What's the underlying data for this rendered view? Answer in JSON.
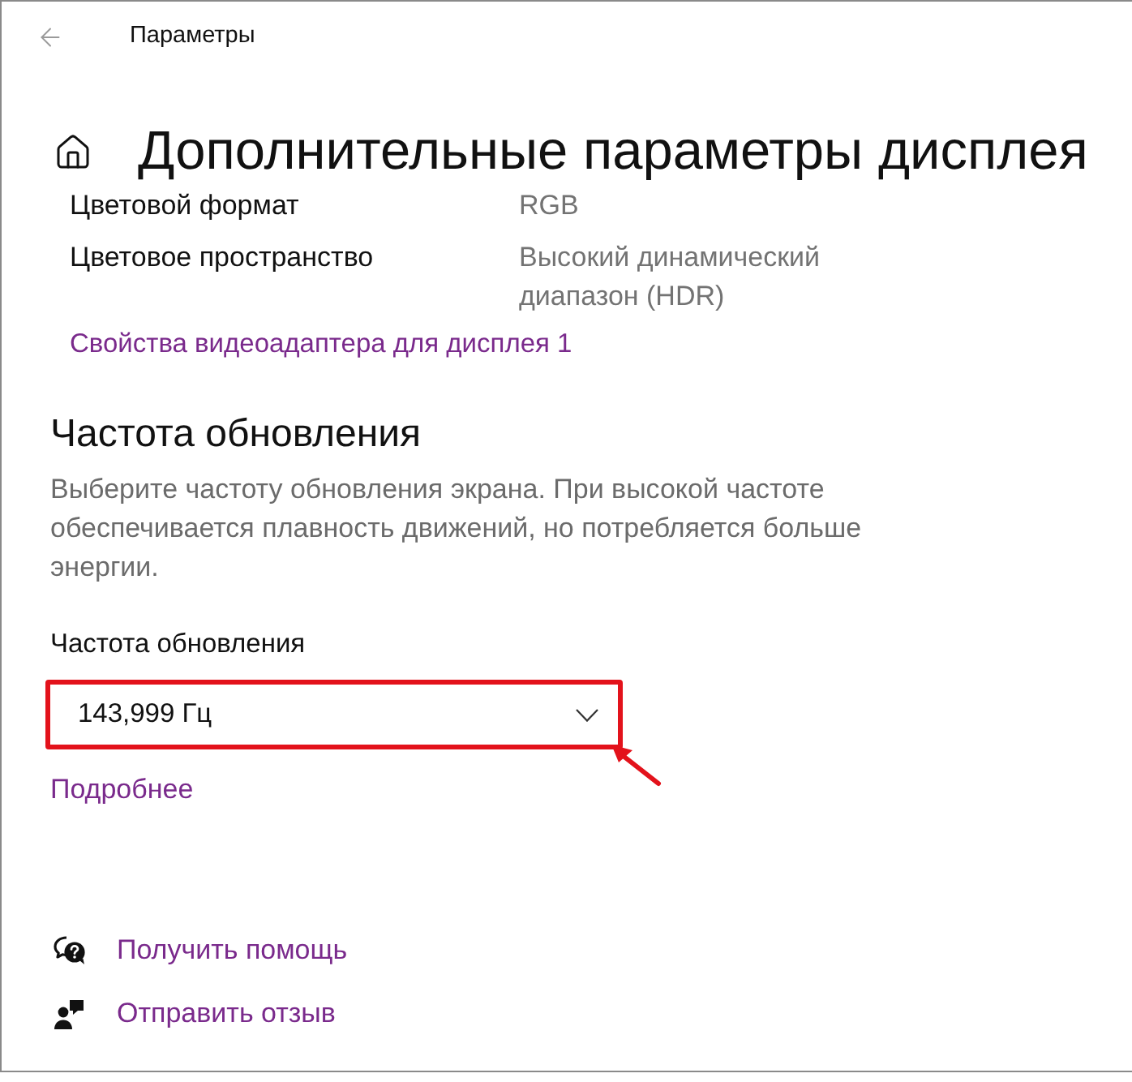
{
  "window": {
    "title": "Параметры"
  },
  "page": {
    "title": "Дополнительные параметры дисплея"
  },
  "info_rows": [
    {
      "label": "Цветовой формат",
      "value": "RGB"
    },
    {
      "label": "Цветовое пространство",
      "value": "Высокий динамический диапазон (HDR)"
    }
  ],
  "adapter_link": "Свойства видеоадаптера для дисплея 1",
  "refresh_section": {
    "heading": "Частота обновления",
    "description": "Выберите частоту обновления экрана. При высокой частоте обеспечивается плавность движений, но потребляется больше энергии.",
    "field_label": "Частота обновления",
    "dropdown": {
      "value": "143,999 Гц",
      "highlighted": true
    },
    "more_link": "Подробнее"
  },
  "footer_links": [
    {
      "kind": "help",
      "label": "Получить помощь"
    },
    {
      "kind": "feedback",
      "label": "Отправить отзыв"
    }
  ]
}
